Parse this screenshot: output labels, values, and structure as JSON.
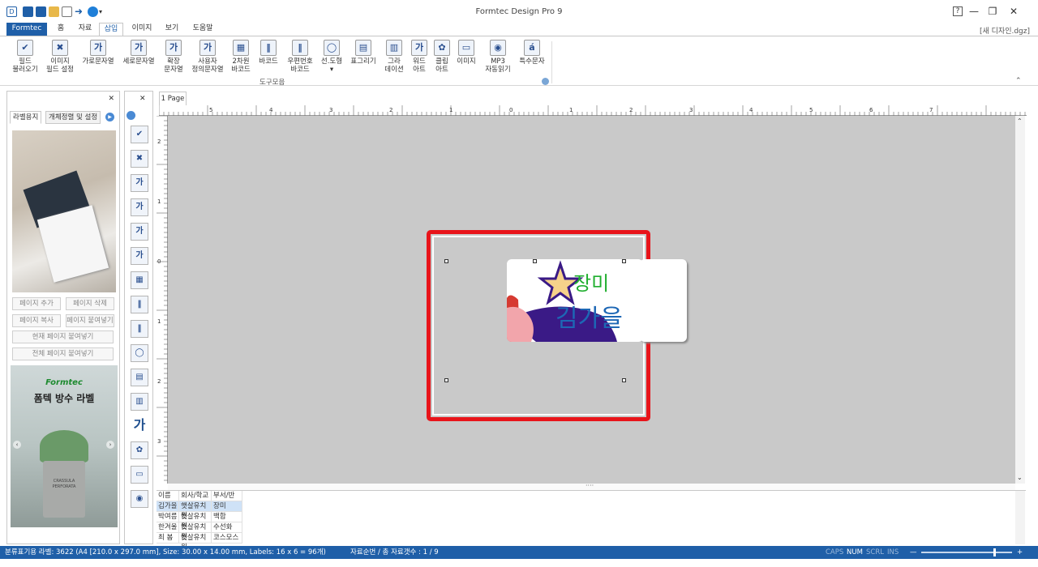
{
  "window": {
    "title": "Formtec Design Pro 9",
    "filename": "[새 디자인.dgz]",
    "controls": {
      "help": "?",
      "minimize": "—",
      "restore": "❐",
      "close": "✕"
    }
  },
  "tabs": [
    {
      "label": "Formtec"
    },
    {
      "label": "홈"
    },
    {
      "label": "자료"
    },
    {
      "label": "삽입"
    },
    {
      "label": "이미지"
    },
    {
      "label": "보기"
    },
    {
      "label": "도움말"
    }
  ],
  "ribbon": {
    "group_label": "도구모음",
    "items": [
      {
        "label1": "필드",
        "label2": "불러오기",
        "icon": "field-load-icon",
        "glyph": "✔"
      },
      {
        "label1": "이미지",
        "label2": "필드 설정",
        "icon": "image-field-icon",
        "glyph": "✖"
      },
      {
        "label1": "가로문자열",
        "label2": "",
        "icon": "horizontal-text-icon",
        "glyph": "가"
      },
      {
        "label1": "세로문자열",
        "label2": "",
        "icon": "vertical-text-icon",
        "glyph": "가"
      },
      {
        "label1": "확장",
        "label2": "문자열",
        "icon": "extended-text-icon",
        "glyph": "가"
      },
      {
        "label1": "사용자",
        "label2": "정의문자열",
        "icon": "custom-text-icon",
        "glyph": "가"
      },
      {
        "label1": "2차원",
        "label2": "바코드",
        "icon": "qr-code-icon",
        "glyph": "▦"
      },
      {
        "label1": "바코드",
        "label2": "",
        "icon": "barcode-icon",
        "glyph": "‖"
      },
      {
        "label1": "우편번호",
        "label2": "바코드",
        "icon": "postal-barcode-icon",
        "glyph": "‖"
      },
      {
        "label1": "선.도형",
        "label2": "▾",
        "icon": "shape-icon",
        "glyph": "◯"
      },
      {
        "label1": "표그리기",
        "label2": "",
        "icon": "table-icon",
        "glyph": "▤"
      },
      {
        "label1": "그라",
        "label2": "데이션",
        "icon": "gradation-icon",
        "glyph": "▥"
      },
      {
        "label1": "워드",
        "label2": "아트",
        "icon": "wordart-icon",
        "glyph": "가"
      },
      {
        "label1": "클립",
        "label2": "아트",
        "icon": "clipart-icon",
        "glyph": "✿"
      },
      {
        "label1": "이미지",
        "label2": "",
        "icon": "image-icon",
        "glyph": "▭"
      },
      {
        "label1": "MP3",
        "label2": "자동읽기",
        "icon": "mp3-icon",
        "glyph": "◉"
      },
      {
        "label1": "특수문자",
        "label2": "",
        "icon": "special-char-icon",
        "glyph": "á"
      }
    ]
  },
  "left_panel": {
    "close": "✕",
    "tabs": [
      "라벨용지",
      "개체정렬 및 설정"
    ],
    "buttons": {
      "add_page": "페이지 추가",
      "delete_page": "페이지 삭제",
      "copy_page": "페이지 복사",
      "paste_page": "페이지 붙여넣기",
      "paste_current": "현재 페이지 붙여넣기",
      "paste_all": "전체 페이지 붙여넣기"
    },
    "ad": {
      "brand": "Formtec",
      "headline": "폼텍 방수 라벨",
      "pot_text": "CRASSULA PERFORATA"
    }
  },
  "tool_panel": {
    "close": "✕",
    "tools": [
      {
        "icon": "field-load-icon",
        "glyph": "✔"
      },
      {
        "icon": "image-field-icon",
        "glyph": "✖"
      },
      {
        "icon": "horizontal-text-icon",
        "glyph": "가"
      },
      {
        "icon": "vertical-text-icon",
        "glyph": "가"
      },
      {
        "icon": "extended-text-icon",
        "glyph": "가"
      },
      {
        "icon": "custom-text-icon",
        "glyph": "가"
      },
      {
        "icon": "qr-code-icon",
        "glyph": "▦"
      },
      {
        "icon": "barcode-icon",
        "glyph": "‖"
      },
      {
        "icon": "postal-barcode-icon",
        "glyph": "‖"
      },
      {
        "icon": "shape-icon",
        "glyph": "◯"
      },
      {
        "icon": "table-icon",
        "glyph": "▤"
      },
      {
        "icon": "gradation-icon",
        "glyph": "▥"
      },
      {
        "icon": "wordart-icon",
        "glyph": "가"
      },
      {
        "icon": "clipart-icon",
        "glyph": "✿"
      },
      {
        "icon": "image-icon",
        "glyph": "▭"
      },
      {
        "icon": "mp3-icon",
        "glyph": "◉"
      }
    ]
  },
  "canvas": {
    "page_tab": "1 Page",
    "hruler_labels": [
      "5",
      "4",
      "3",
      "2",
      "1",
      "0",
      "1",
      "2",
      "3",
      "4",
      "5",
      "6",
      "7"
    ],
    "vruler_labels": [
      "2",
      "1",
      "0",
      "1",
      "2",
      "3"
    ],
    "label": {
      "name_line1": "장미",
      "name_line2": "김가을"
    }
  },
  "grid": {
    "headers": [
      "이름",
      "회사/학교",
      "부서/반"
    ],
    "rows": [
      [
        "김가을",
        "햇살유치원",
        "장미"
      ],
      [
        "박여름",
        "햇살유치원",
        "백합"
      ],
      [
        "한겨울",
        "햇살유치원",
        "수선화"
      ],
      [
        "최 봄",
        "햇살유치원",
        "코스모스"
      ]
    ]
  },
  "statusbar": {
    "info": "분류표기용 라벨: 3622 (A4 [210.0 x 297.0 mm], Size: 30.00 x 14.00 mm,  Labels: 16 x 6 = 96개)",
    "record": "자료순번 / 총 자료갯수 : 1 / 9",
    "caps": "CAPS",
    "num": "NUM",
    "scrl": "SCRL",
    "ins": "INS",
    "zoom_minus": "—",
    "zoom_plus": "+"
  }
}
